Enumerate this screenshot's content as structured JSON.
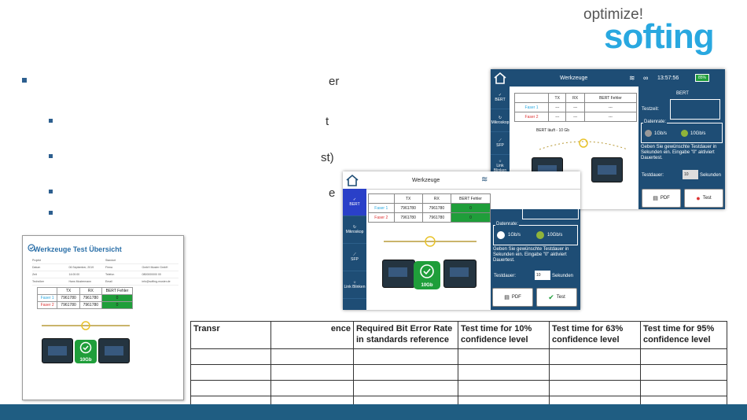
{
  "logo": {
    "tagline": "optimize!",
    "brand": "softing"
  },
  "slide_fragments": [
    "er",
    "t",
    "st)",
    "e"
  ],
  "report": {
    "title": "Werkzeuge Test Übersicht",
    "info_rows": [
      [
        "Projekt",
        "",
        "Standort",
        ""
      ],
      [
        "Datum",
        "06 September, 2019",
        "Firma",
        "GmbH Muster GmbH"
      ],
      [
        "Zeit",
        "14:00:00",
        "Telefon",
        "0800000000 00"
      ],
      [
        "Techniker",
        "Hans Mustermann",
        "Email",
        "info@softing-muster.de"
      ]
    ],
    "table": {
      "headers": [
        "",
        "TX",
        "RX",
        "BERT Fehler"
      ],
      "rows": [
        [
          "Faser 1",
          "7961780",
          "7961780",
          "0"
        ],
        [
          "Faser 2",
          "7961780",
          "7961780",
          "0"
        ]
      ]
    },
    "speed_badge": "10Gb"
  },
  "device_back": {
    "header_title": "Werkzeuge",
    "time": "13:57:56",
    "battery": "85%",
    "sidebar": [
      "BERT",
      "Mikroskop",
      "SFP",
      "Link Blinken"
    ],
    "table": {
      "headers": [
        "",
        "TX",
        "RX",
        "BERT Fehler"
      ],
      "rows": [
        [
          "Faser 1",
          "---",
          "---",
          "---"
        ],
        [
          "Faser 2",
          "---",
          "---",
          "---"
        ]
      ]
    },
    "status": "BERT läuft - 10 Gb",
    "panel_title": "BERT",
    "testzeit_label": "Testzeit:",
    "datenrate_label": "Datenrate:",
    "rate1": "1Gb/s",
    "rate2": "10Gb/s",
    "hint": "Geben Sie gewünschte Testdauer in Sekunden ein. Eingabe \"0\" aktiviert Dauertest.",
    "dauer_label": "Testdauer:",
    "dauer_value": "10",
    "dauer_unit": "Sekunden",
    "btn_pdf": "PDF",
    "btn_test": "Test"
  },
  "device_front": {
    "header_title": "Werkzeuge",
    "sidebar": [
      "BERT",
      "Mikroskop",
      "SFP",
      "Link Blinken"
    ],
    "table": {
      "headers": [
        "",
        "TX",
        "RX",
        "BERT Fehler"
      ],
      "rows": [
        [
          "Faser 1",
          "7961780",
          "7961780",
          "0"
        ],
        [
          "Faser 2",
          "7961780",
          "7961780",
          "0"
        ]
      ]
    },
    "speed_badge": "10Gb",
    "datenrate_label": "Datenrate:",
    "rate1": "1Gb/s",
    "rate2": "10Gb/s",
    "hint": "Geben Sie gewünschte Testdauer in Sekunden ein. Eingabe \"0\" aktiviert Dauertest.",
    "dauer_label": "Testdauer:",
    "dauer_value": "10",
    "dauer_unit": "Sekunden",
    "btn_pdf": "PDF",
    "btn_test": "Test"
  },
  "standards_table": {
    "headers": [
      "Transr",
      "ence",
      "Required Bit Error Rate in standards reference",
      "Test time for 10% confidence level",
      "Test time for 63% confidence level",
      "Test time for 95% confidence level"
    ]
  },
  "colors": {
    "brand": "#29a8e0",
    "band": "#1f5d82",
    "device_blue": "#1e4d75",
    "ok_green": "#1f9e3a"
  }
}
